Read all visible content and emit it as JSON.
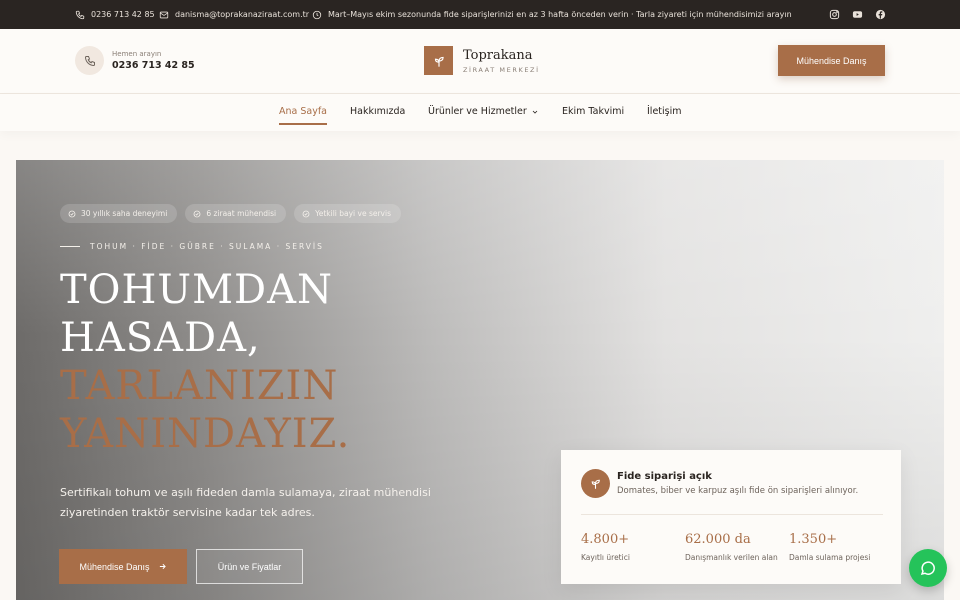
{
  "topbar": {
    "phone": "0236 713 42 85",
    "email": "danisma@toprakanaziraat.com.tr",
    "notice": "Mart–Mayıs ekim sezonunda fide siparişlerinizi en az 3 hafta önceden verin · Tarla ziyareti için mühendisimizi arayın",
    "social_icons": [
      "instagram-icon",
      "youtube-icon",
      "facebook-icon"
    ]
  },
  "header": {
    "call_label": "Hemen arayın",
    "call_number": "0236 713 42 85",
    "logo_name": "Toprakana",
    "logo_sub": "ZİRAAT MERKEZİ",
    "cta": "Mühendise Danış"
  },
  "nav": {
    "items": [
      {
        "label": "Ana Sayfa",
        "active": true
      },
      {
        "label": "Hakkımızda"
      },
      {
        "label": "Ürünler ve Hizmetler",
        "dropdown": true
      },
      {
        "label": "Ekim Takvimi"
      },
      {
        "label": "İletişim"
      }
    ]
  },
  "hero": {
    "chips": [
      "30 yıllık saha deneyimi",
      "6 ziraat mühendisi",
      "Yetkili bayi ve servis"
    ],
    "eyebrow": "TOHUM · FİDE · GÜBRE · SULAMA · SERVİS",
    "headline_white_1": "TOHUMDAN",
    "headline_white_2": "HASADA,",
    "headline_brown_1": "TARLANIZIN",
    "headline_brown_2": "YANINDAYIZ.",
    "lead": "Sertifikalı tohum ve aşılı fideden damla sulamaya, ziraat mühendisi ziyaretinden traktör servisine kadar tek adres.",
    "primary_button": "Mühendise Danış",
    "secondary_button": "Ürün ve Fiyatlar"
  },
  "card": {
    "title": "Fide siparişi açık",
    "subtitle": "Domates, biber ve karpuz aşılı fide ön siparişleri alınıyor.",
    "stats": [
      {
        "value": "4.800+",
        "label": "Kayıtlı üretici"
      },
      {
        "value": "62.000 da",
        "label": "Danışmanlık verilen alan"
      },
      {
        "value": "1.350+",
        "label": "Damla sulama projesi"
      }
    ]
  },
  "colors": {
    "accent": "#a86e48",
    "dark": "#2a2522",
    "whatsapp": "#25c35a"
  }
}
